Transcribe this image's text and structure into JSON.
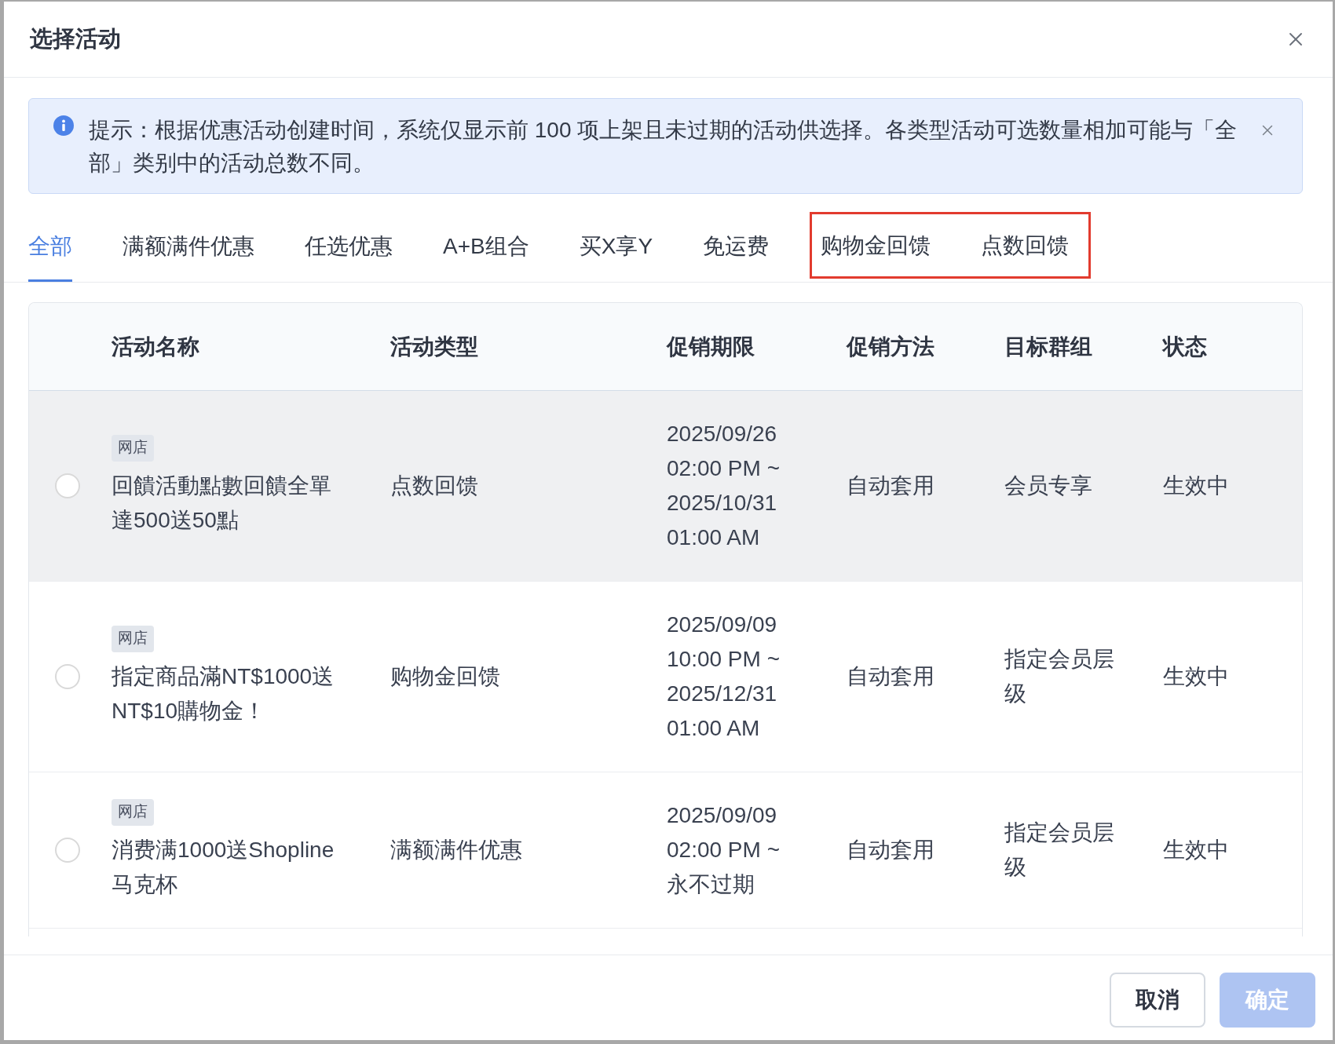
{
  "dialog": {
    "title": "选择活动"
  },
  "notice": {
    "text": "提示：根据优惠活动创建时间，系统仅显示前 100 项上架且未过期的活动供选择。各类型活动可选数量相加可能与「全部」类别中的活动总数不同。"
  },
  "tabs": [
    {
      "label": "全部",
      "selected": true,
      "highlighted": false
    },
    {
      "label": "满额满件优惠",
      "selected": false,
      "highlighted": false
    },
    {
      "label": "任选优惠",
      "selected": false,
      "highlighted": false
    },
    {
      "label": "A+B组合",
      "selected": false,
      "highlighted": false
    },
    {
      "label": "买X享Y",
      "selected": false,
      "highlighted": false
    },
    {
      "label": "免运费",
      "selected": false,
      "highlighted": false
    },
    {
      "label": "购物金回馈",
      "selected": false,
      "highlighted": true
    },
    {
      "label": "点数回馈",
      "selected": false,
      "highlighted": true
    }
  ],
  "table": {
    "columns": [
      "活动名称",
      "活动类型",
      "促销期限",
      "促销方法",
      "目标群组",
      "状态"
    ],
    "rows": [
      {
        "selected": false,
        "hovered": true,
        "tag": "网店",
        "name": "回饋活動點數回饋全單達500送50點",
        "type": "点数回馈",
        "period": "2025/09/26 02:00 PM ~ 2025/10/31 01:00 AM",
        "method": "自动套用",
        "target": "会员专享",
        "status": "生效中"
      },
      {
        "selected": false,
        "hovered": false,
        "tag": "网店",
        "name": "指定商品滿NT$1000送NT$10購物金！",
        "type": "购物金回馈",
        "period": "2025/09/09 10:00 PM ~ 2025/12/31 01:00 AM",
        "method": "自动套用",
        "target": "指定会员层级",
        "status": "生效中"
      },
      {
        "selected": false,
        "hovered": false,
        "tag": "网店",
        "name": "消费满1000送Shopline马克杯",
        "type": "满额满件优惠",
        "period": "2025/09/09 02:00 PM ~ 永不过期",
        "method": "自动套用",
        "target": "指定会员层级",
        "status": "生效中"
      }
    ]
  },
  "buttons": [
    {
      "label": "取消",
      "kind": "secondary",
      "disabled": false
    },
    {
      "label": "确定",
      "kind": "primary",
      "disabled": true
    }
  ]
}
